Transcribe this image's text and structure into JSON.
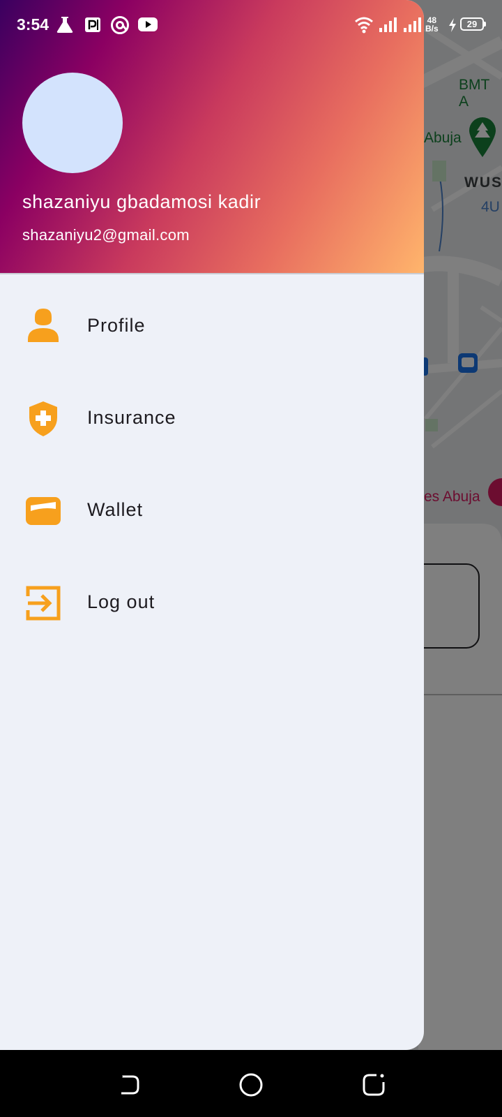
{
  "status_bar": {
    "time": "3:54",
    "net_speed_value": "48",
    "net_speed_unit": "B/s",
    "battery": "29",
    "icons": [
      "flask-icon",
      "parking-icon",
      "at-sign-icon",
      "youtube-icon",
      "wifi-icon",
      "signal-icon",
      "signal-icon",
      "charging-icon"
    ]
  },
  "map": {
    "labels": [
      "BMT A",
      "Abuja",
      "WUSE",
      "4U",
      "es Abuja"
    ]
  },
  "drawer": {
    "user": {
      "name": "shazaniyu gbadamosi kadir",
      "email": "shazaniyu2@gmail.com"
    },
    "items": [
      {
        "label": "Profile",
        "icon": "person-icon"
      },
      {
        "label": "Insurance",
        "icon": "shield-plus-icon"
      },
      {
        "label": "Wallet",
        "icon": "wallet-icon"
      },
      {
        "label": "Log out",
        "icon": "logout-icon"
      }
    ]
  },
  "nav_bar": {
    "icons": [
      "back-icon",
      "home-icon",
      "recents-icon"
    ]
  },
  "colors": {
    "accent": "#f7a01d",
    "drawer_bg": "#eef1f8",
    "avatar_bg": "#d3e3fd",
    "header_gradient": [
      "#3a0060",
      "#8b0062",
      "#c93a5d",
      "#e86e5f",
      "#ffb56c"
    ]
  }
}
